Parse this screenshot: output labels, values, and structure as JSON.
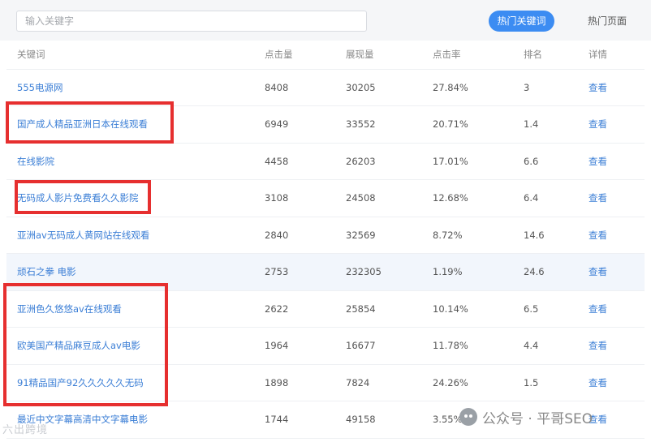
{
  "search": {
    "placeholder": "输入关键字"
  },
  "toolbar": {
    "hot_keywords_label": "热门关键词",
    "hot_pages_label": "热门页面"
  },
  "columns": [
    "关键词",
    "点击量",
    "展现量",
    "点击率",
    "排名",
    "详情"
  ],
  "rows": [
    {
      "keyword": "555电源网",
      "clicks": "8408",
      "impressions": "30205",
      "ctr": "27.84%",
      "rank": "3",
      "action": "查看"
    },
    {
      "keyword": "国产成人精品亚洲日本在线观看",
      "clicks": "6949",
      "impressions": "33552",
      "ctr": "20.71%",
      "rank": "1.4",
      "action": "查看"
    },
    {
      "keyword": "在线影院",
      "clicks": "4458",
      "impressions": "26203",
      "ctr": "17.01%",
      "rank": "6.6",
      "action": "查看"
    },
    {
      "keyword": "无码成人影片免费看久久影院",
      "clicks": "3108",
      "impressions": "24508",
      "ctr": "12.68%",
      "rank": "6.4",
      "action": "查看"
    },
    {
      "keyword": "亚洲av无码成人黄网站在线观看",
      "clicks": "2840",
      "impressions": "32569",
      "ctr": "8.72%",
      "rank": "14.6",
      "action": "查看"
    },
    {
      "keyword": "顽石之拳 电影",
      "clicks": "2753",
      "impressions": "232305",
      "ctr": "1.19%",
      "rank": "24.6",
      "action": "查看"
    },
    {
      "keyword": "亚洲色久悠悠av在线观看",
      "clicks": "2622",
      "impressions": "25854",
      "ctr": "10.14%",
      "rank": "6.5",
      "action": "查看"
    },
    {
      "keyword": "欧美国产精品麻豆成人av电影",
      "clicks": "1964",
      "impressions": "16677",
      "ctr": "11.78%",
      "rank": "4.4",
      "action": "查看"
    },
    {
      "keyword": "91精品国产92久久久久久无码",
      "clicks": "1898",
      "impressions": "7824",
      "ctr": "24.26%",
      "rank": "1.5",
      "action": "查看"
    },
    {
      "keyword": "最近中文字幕高清中文字幕电影",
      "clicks": "1744",
      "impressions": "49158",
      "ctr": "3.55%",
      "rank": "",
      "action": "查看"
    }
  ],
  "watermarks": {
    "left": "六出跨境",
    "right": "公众号 · 平哥SEO"
  },
  "colors": {
    "accent": "#3c8cf2",
    "link": "#3c7fd6",
    "highlight_box": "#e62f2f",
    "hover_row": "#f2f6fc"
  }
}
